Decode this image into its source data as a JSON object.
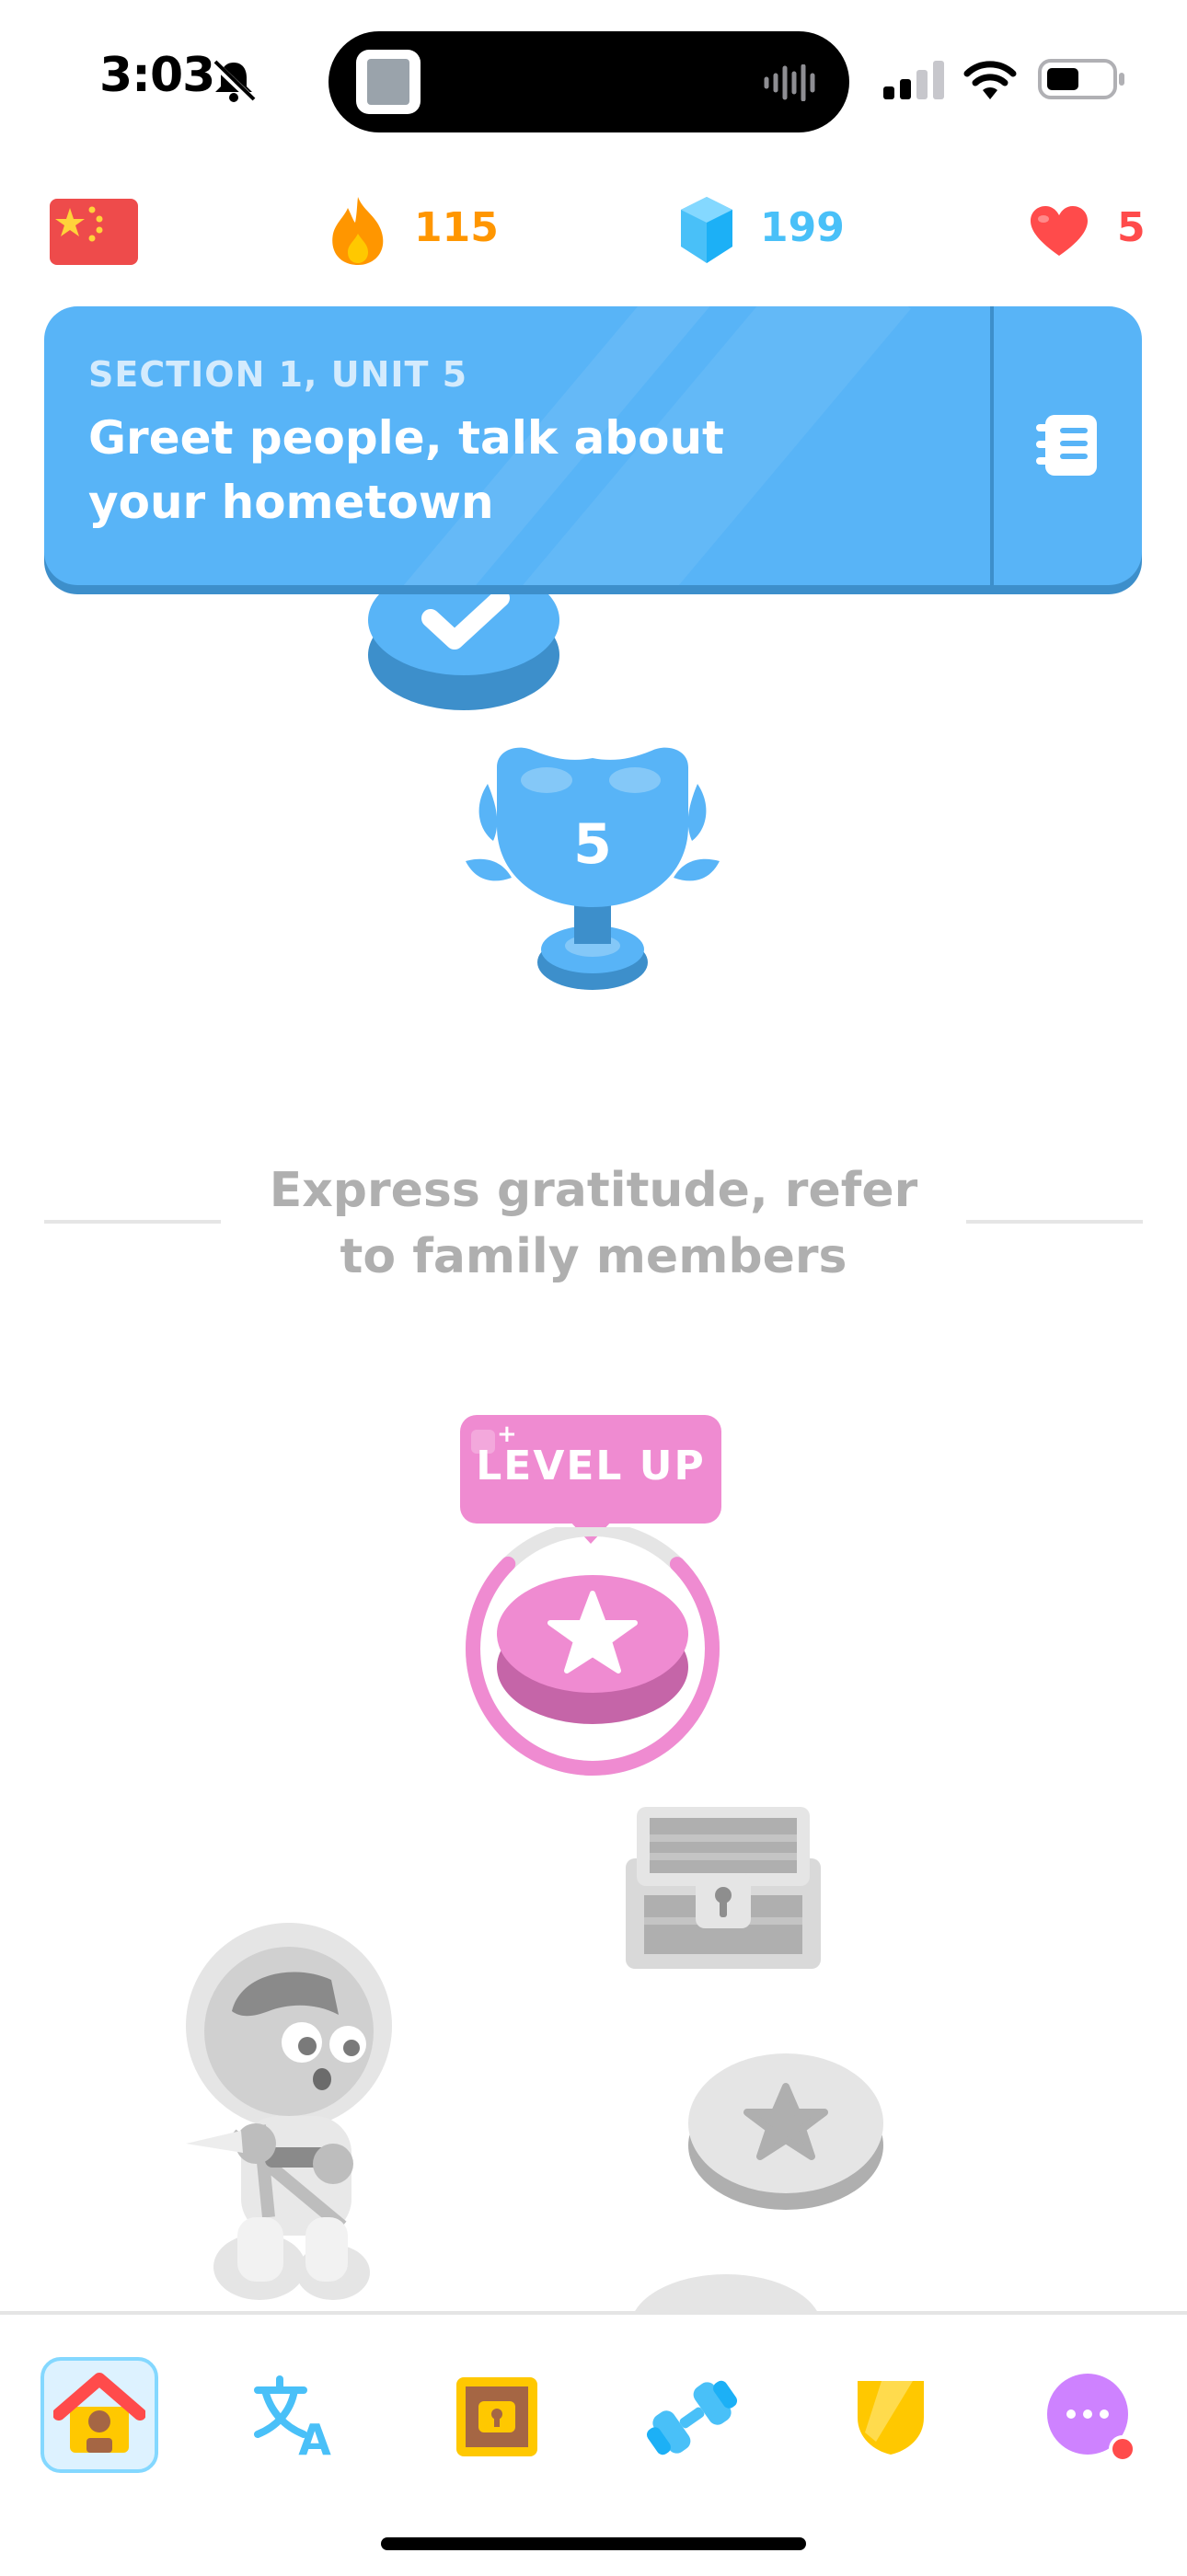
{
  "status_bar": {
    "time": "3:03",
    "icons": [
      "bell-slash-icon",
      "signal-icon",
      "wifi-icon",
      "battery-icon"
    ]
  },
  "top_stats": {
    "language_flag": "china-flag-icon",
    "streak": "115",
    "gems": "199",
    "hearts": "5"
  },
  "unit_banner": {
    "section_label": "SECTION 1, UNIT 5",
    "title": "Greet people, talk about your hometown",
    "guidebook_icon": "guidebook-icon"
  },
  "path": {
    "trophy_level": "5",
    "next_unit_title": "Express gratitude, refer to family members",
    "level_up_label": "LEVEL UP",
    "level_up_progress": 0.75
  },
  "bottom_nav": {
    "items": [
      "home",
      "characters",
      "shop-chest",
      "practice",
      "leagues",
      "more"
    ]
  },
  "colors": {
    "blue": "#58b4f7",
    "streak_orange": "#ff9600",
    "gem_blue": "#49c0f8",
    "heart_red": "#ff4b4b",
    "pink": "#ef8bd1",
    "gray": "#afafaf"
  }
}
